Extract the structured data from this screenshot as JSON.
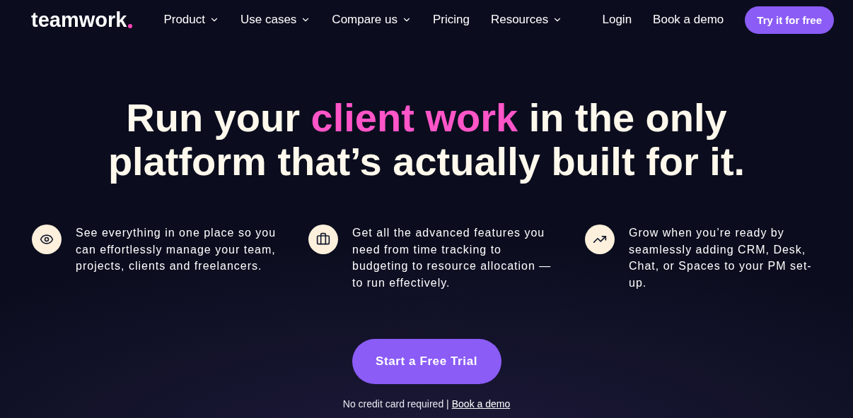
{
  "logo": "teamwork",
  "nav": [
    {
      "label": "Product",
      "dropdown": true
    },
    {
      "label": "Use cases",
      "dropdown": true
    },
    {
      "label": "Compare us",
      "dropdown": true
    },
    {
      "label": "Pricing",
      "dropdown": false
    },
    {
      "label": "Resources",
      "dropdown": true
    }
  ],
  "login": "Login",
  "book_demo": "Book a demo",
  "try_button": "Try it for free",
  "headline": [
    {
      "segments": [
        {
          "text": "Run your ",
          "highlight": false
        },
        {
          "text": "client work",
          "highlight": true
        },
        {
          "text": " in the only",
          "highlight": false
        }
      ]
    },
    {
      "segments": [
        {
          "text": "platform that’s actually built for it.",
          "highlight": false
        }
      ]
    }
  ],
  "features": [
    {
      "text": "See everything in one place so you can effortlessly manage your team, projects, clients and freelancers."
    },
    {
      "text": "Get all the advanced features you need from time tracking to budgeting to resource allocation — to run effectively."
    },
    {
      "text": "Grow when you’re ready by seamlessly adding CRM, Desk, Chat, or Spaces to your PM set-up."
    }
  ],
  "cta": "Start a Free Trial",
  "note": "No credit card required |",
  "note_link": "Book a demo"
}
